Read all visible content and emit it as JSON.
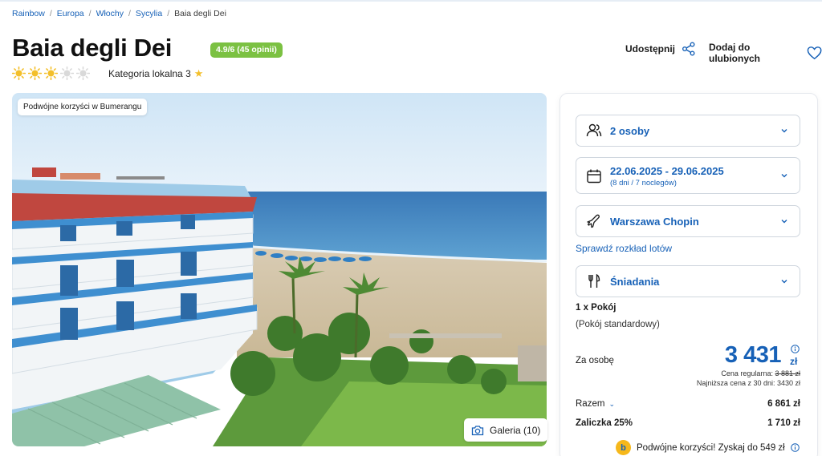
{
  "breadcrumb": [
    "Rainbow",
    "Europa",
    "Włochy",
    "Sycylia",
    "Baia degli Dei"
  ],
  "hotel": {
    "name": "Baia degli Dei",
    "rating_badge": "4.9/6 (45 opinii)",
    "stars_filled": 3,
    "stars_total": 5,
    "category": "Kategoria lokalna 3"
  },
  "actions": {
    "share_label": "Udostępnij",
    "favorite_label": "Dodaj do ulubionych"
  },
  "gallery": {
    "promo_tag": "Podwójne korzyści w Bumerangu",
    "button_label": "Galeria (10)"
  },
  "booking": {
    "guests": "2 osoby",
    "dates": "22.06.2025 - 29.06.2025",
    "dates_sub": "(8 dni / 7 noclegów)",
    "departure": "Warszawa Chopin",
    "flights_link": "Sprawdź rozkład lotów",
    "board": "Śniadania",
    "room_count": "1 x Pokój",
    "room_type": "(Pokój standardowy)",
    "per_person_label": "Za osobę",
    "price": "3 431",
    "currency": "zł",
    "regular_price_label": "Cena regularna:",
    "regular_price": "3 881 zł",
    "lowest_price": "Najniższa cena z 30 dni: 3430 zł",
    "total_label": "Razem",
    "total_value": "6 861 zł",
    "deposit_label": "Zaliczka 25%",
    "deposit_value": "1 710 zł",
    "bonus_text": "Podwójne korzyści! Zyskaj do 549 zł"
  },
  "colors": {
    "brand_blue": "#1761b7",
    "rating_green": "#7bc142",
    "star_yellow": "#f3bf2a"
  }
}
